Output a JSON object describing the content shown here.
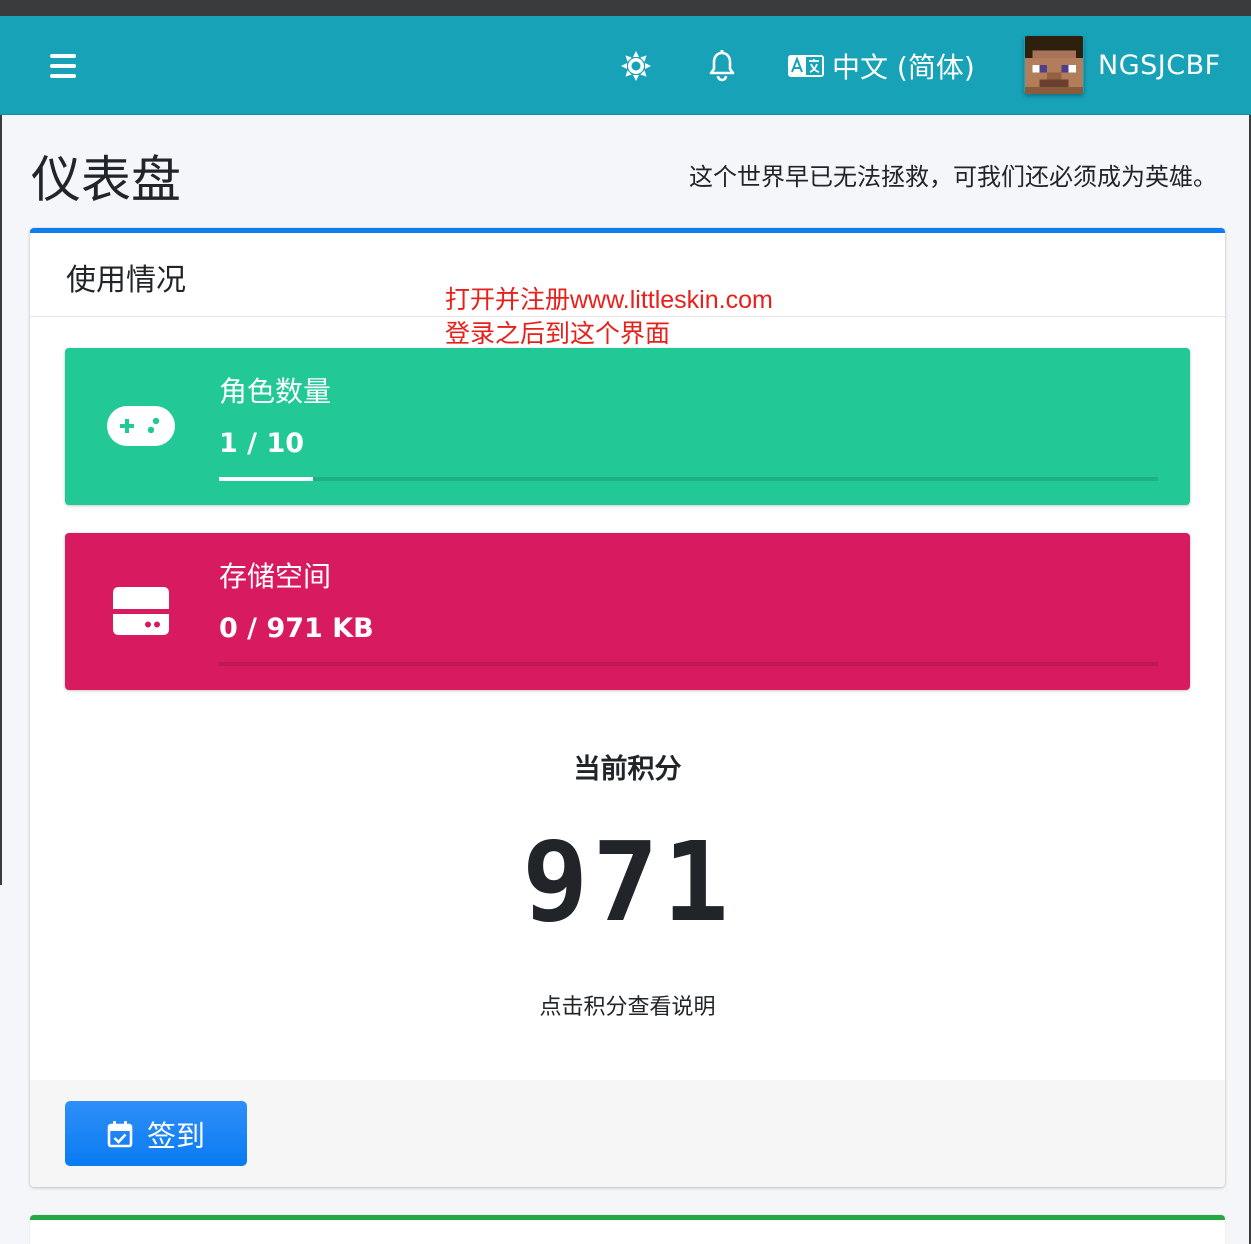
{
  "navbar": {
    "menu_icon": "bars-icon",
    "theme_icon": "sun-icon",
    "notification_icon": "bell-icon",
    "language_icon": "translate-icon",
    "language_label": "中文 (简体)",
    "username": "NGSJCBF"
  },
  "header": {
    "title": "仪表盘",
    "motto": "这个世界早已无法拯救，可我们还必须成为英雄。"
  },
  "usage_card": {
    "title": "使用情况",
    "annotation_line1": "打开并注册www.littleskin.com",
    "annotation_line2": "登录之后到这个界面",
    "players": {
      "icon": "gamepad-icon",
      "label": "角色数量",
      "value": "1 / 10",
      "progress_fraction": 0.1,
      "color": "#22c997"
    },
    "storage": {
      "icon": "hdd-icon",
      "label": "存储空间",
      "value": "0 / 971 KB",
      "progress_fraction": 0,
      "color": "#d81b60"
    },
    "score_title": "当前积分",
    "score_value": "971",
    "score_hint": "点击积分查看说明",
    "checkin_icon": "calendar-check-icon",
    "checkin_label": "签到",
    "accent_color": "#0d7ef0"
  }
}
